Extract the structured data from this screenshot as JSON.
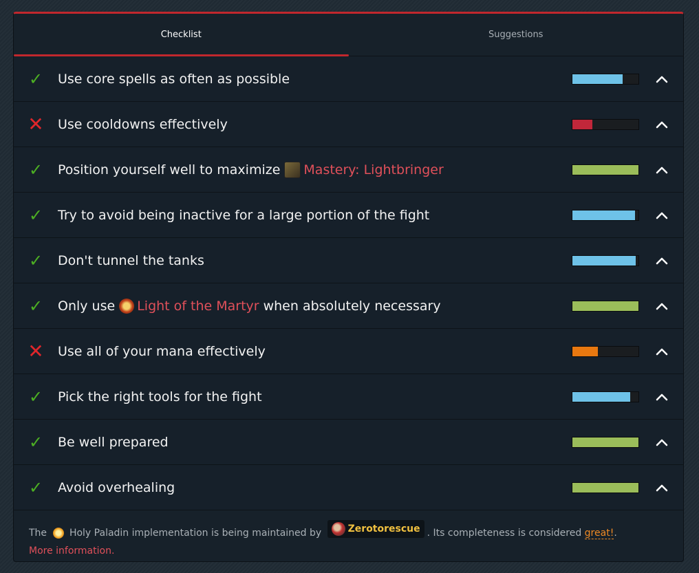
{
  "tabs": [
    {
      "label": "Checklist",
      "active": true
    },
    {
      "label": "Suggestions",
      "active": false
    }
  ],
  "checklist": [
    {
      "status": "pass",
      "text": "Use core spells as often as possible",
      "bar_fill": 0.76,
      "bar_color": "#6ec2e8"
    },
    {
      "status": "fail",
      "text": "Use cooldowns effectively",
      "bar_fill": 0.3,
      "bar_color": "#c1273a"
    },
    {
      "status": "pass",
      "text": "Position yourself well to maximize",
      "spell": "Mastery: Lightbringer",
      "spell_icon": "mastery-lightbringer-icon",
      "bar_fill": 1.0,
      "bar_color": "#9bbd5a"
    },
    {
      "status": "pass",
      "text": "Try to avoid being inactive for a large portion of the fight",
      "bar_fill": 0.95,
      "bar_color": "#6ec2e8"
    },
    {
      "status": "pass",
      "text": "Don't tunnel the tanks",
      "bar_fill": 0.96,
      "bar_color": "#6ec2e8"
    },
    {
      "status": "pass",
      "text": "Only use",
      "spell": "Light of the Martyr",
      "spell_icon": "light-of-the-martyr-icon",
      "text_after": "when absolutely necessary",
      "bar_fill": 1.0,
      "bar_color": "#9bbd5a"
    },
    {
      "status": "fail",
      "text": "Use all of your mana effectively",
      "bar_fill": 0.39,
      "bar_color": "#e87810"
    },
    {
      "status": "pass",
      "text": "Pick the right tools for the fight",
      "bar_fill": 0.88,
      "bar_color": "#6ec2e8"
    },
    {
      "status": "pass",
      "text": "Be well prepared",
      "bar_fill": 1.0,
      "bar_color": "#9bbd5a"
    },
    {
      "status": "pass",
      "text": "Avoid overhealing",
      "bar_fill": 1.0,
      "bar_color": "#9bbd5a"
    }
  ],
  "footer": {
    "the": "The",
    "spec_text": "Holy Paladin implementation is being maintained by",
    "author": "Zerotorescue",
    "completeness_text": ". Its completeness is considered",
    "completeness_value": "great!",
    "period": ".",
    "more_info": "More information."
  },
  "colors": {
    "accent": "#c1272d",
    "pass": "#4caf23",
    "fail": "#e0262b",
    "spell": "#e0505a",
    "author": "#f0c040",
    "great": "#f08a24"
  }
}
